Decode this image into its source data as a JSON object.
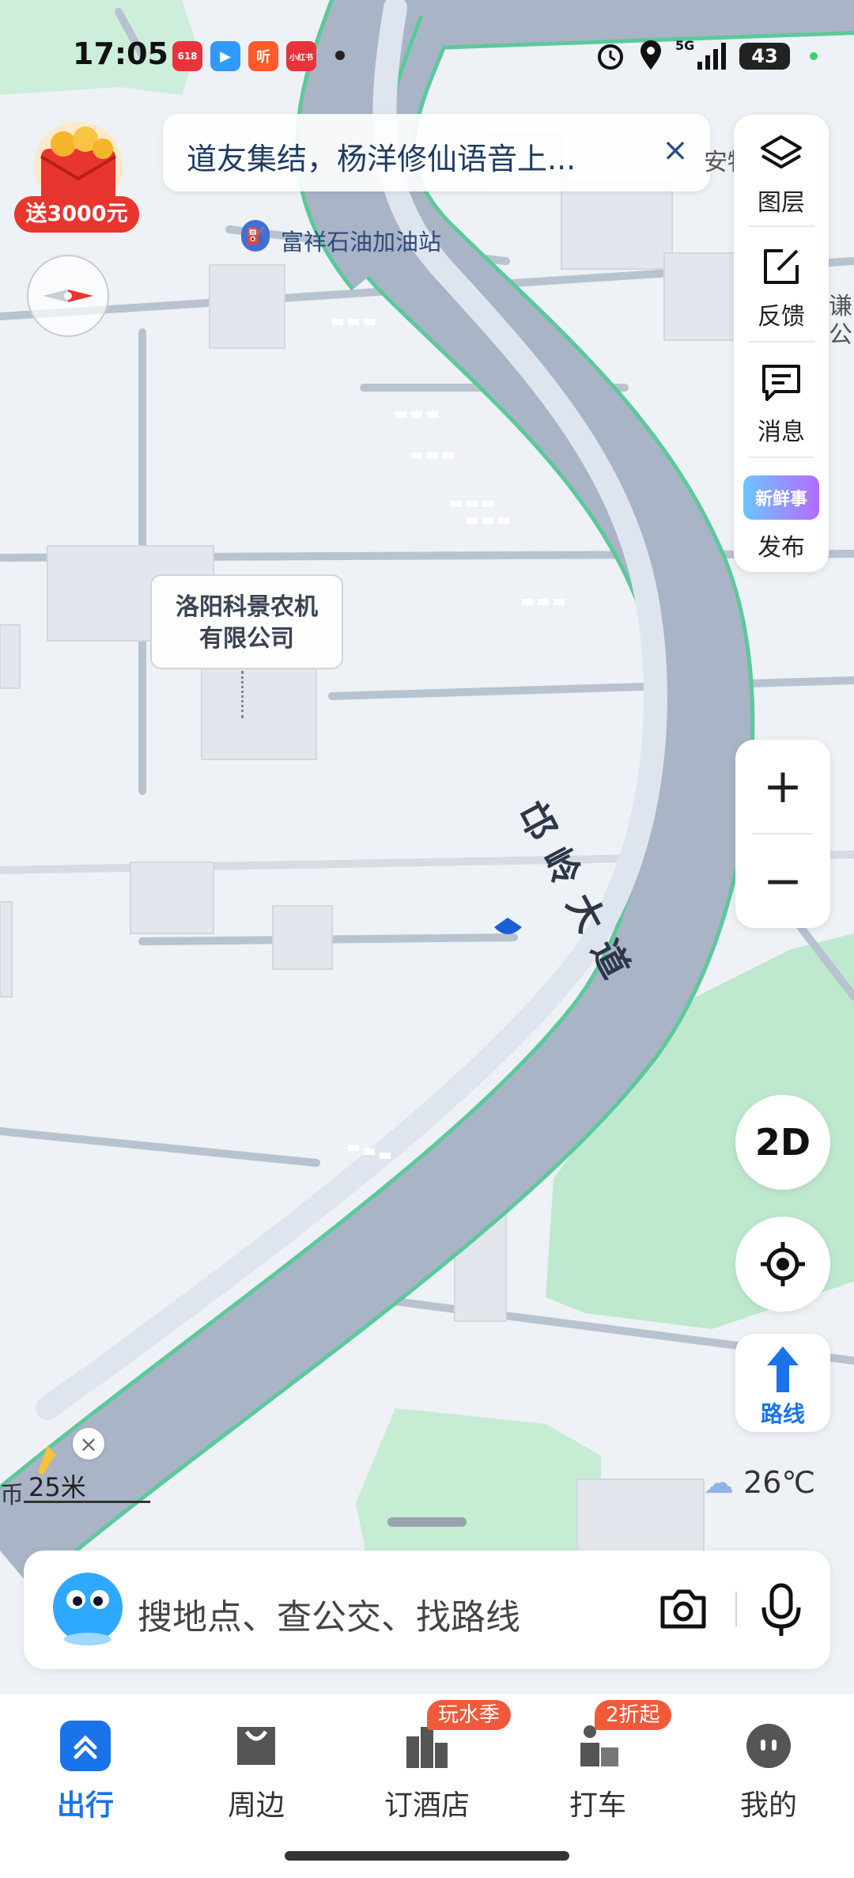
{
  "status_bar": {
    "time": "17:05",
    "apps": [
      {
        "name": "app-icon-1",
        "color": "#e8333a",
        "text": "618"
      },
      {
        "name": "app-icon-2",
        "color": "#2f9bff",
        "text": "▶"
      },
      {
        "name": "app-icon-3",
        "color": "#ff5a2a",
        "text": "听"
      },
      {
        "name": "app-icon-4",
        "color": "#e8333a",
        "text": "小红书"
      }
    ],
    "network": "5G",
    "battery": "43"
  },
  "notice": {
    "text": "道友集结，杨洋修仙语音上...",
    "close": "×"
  },
  "promo": {
    "label": "送3000元"
  },
  "toolbar": {
    "items": [
      {
        "label": "图层",
        "icon": "layers-icon"
      },
      {
        "label": "反馈",
        "icon": "feedback-icon"
      },
      {
        "label": "消息",
        "icon": "message-icon"
      },
      {
        "label": "发布",
        "icon": "publish-icon",
        "badge": "新鲜事"
      }
    ]
  },
  "zoom": {
    "in": "+",
    "out": "−"
  },
  "view_mode": "2D",
  "route": {
    "label": "路线"
  },
  "map": {
    "road_name": "邙岭大道",
    "gas_station": "富祥石油加油站",
    "company_line1": "洛阳科景农机",
    "company_line2": "有限公司",
    "edge_label_right": "谦\n公",
    "edge_label_right_top": "安物"
  },
  "scale": {
    "value": "25米",
    "close": "×",
    "edge_text": "币"
  },
  "weather": {
    "temperature": "26℃"
  },
  "search": {
    "placeholder": "搜地点、查公交、找路线"
  },
  "tabs": [
    {
      "label": "出行",
      "icon": "travel-icon",
      "active": true
    },
    {
      "label": "周边",
      "icon": "nearby-icon"
    },
    {
      "label": "订酒店",
      "icon": "hotel-icon",
      "badge": "玩水季"
    },
    {
      "label": "打车",
      "icon": "taxi-icon",
      "badge": "2折起"
    },
    {
      "label": "我的",
      "icon": "profile-icon"
    }
  ],
  "colors": {
    "accent": "#1a73e8",
    "road": "#a9b4c6",
    "road_edge": "#5cc99a",
    "green_area": "#c2ecd1",
    "badge": "#f05a3a"
  }
}
